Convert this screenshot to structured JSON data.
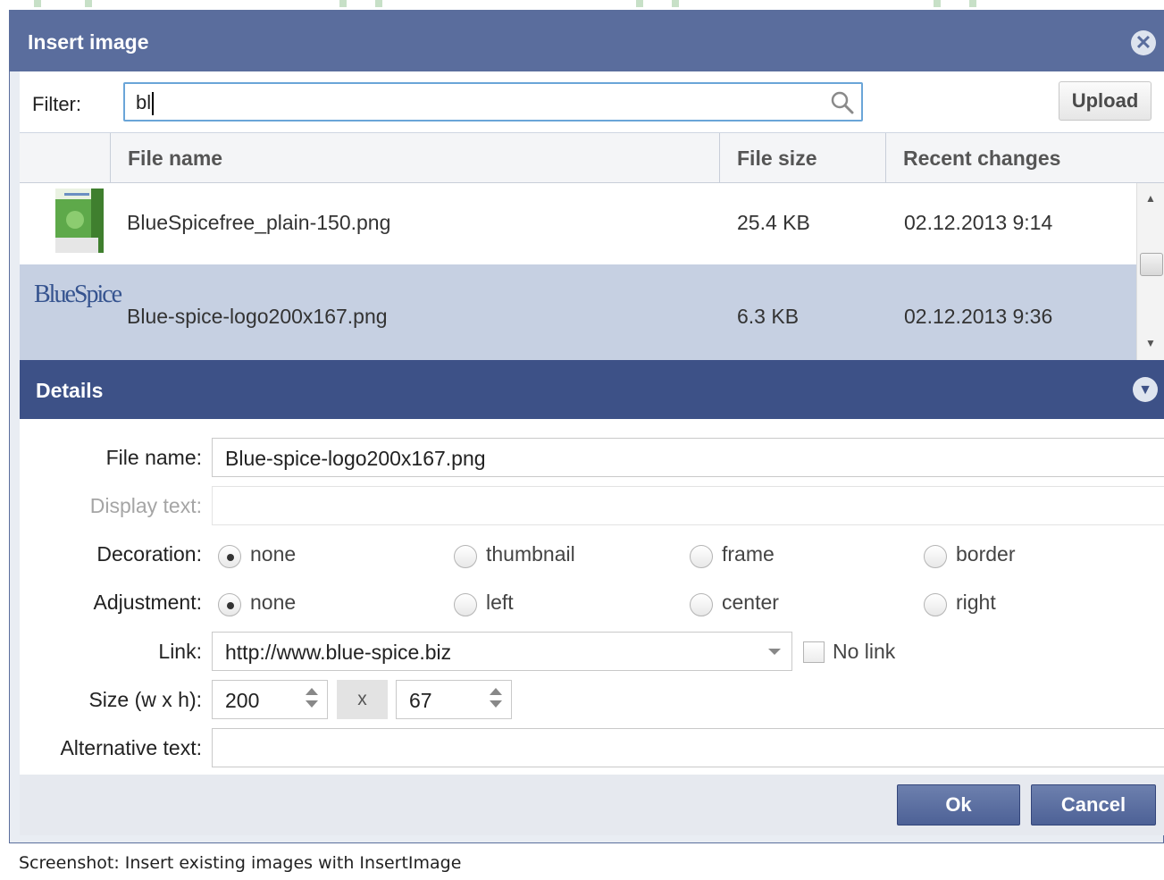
{
  "dialog": {
    "title": "Insert image",
    "close_icon": "close-circle-icon"
  },
  "filter": {
    "label": "Filter:",
    "value": "bl",
    "search_icon": "search-icon",
    "upload_label": "Upload"
  },
  "grid": {
    "columns": [
      "File name",
      "File size",
      "Recent changes"
    ],
    "rows": [
      {
        "file_name": "BlueSpicefree_plain-150.png",
        "file_size": "25.4 KB",
        "recent_changes": "02.12.2013 9:14",
        "selected": false
      },
      {
        "file_name": "Blue-spice-logo200x167.png",
        "file_size": "6.3 KB",
        "recent_changes": "02.12.2013 9:36",
        "selected": true
      }
    ],
    "logo_text": "BlueSpice"
  },
  "details": {
    "title": "Details",
    "expand_icon": "chevron-down-circle-icon",
    "file_name_label": "File name:",
    "file_name_value": "Blue-spice-logo200x167.png",
    "display_text_label": "Display text:",
    "display_text_value": "",
    "decoration": {
      "label": "Decoration:",
      "options": [
        "none",
        "thumbnail",
        "frame",
        "border"
      ],
      "selected": "none"
    },
    "adjustment": {
      "label": "Adjustment:",
      "options": [
        "none",
        "left",
        "center",
        "right"
      ],
      "selected": "none"
    },
    "link_label": "Link:",
    "link_value": "http://www.blue-spice.biz",
    "no_link_label": "No link",
    "size_label": "Size (w x h):",
    "width": "200",
    "size_separator": "x",
    "height": "67",
    "alt_text_label": "Alternative text:",
    "alt_text_value": ""
  },
  "footer": {
    "ok_label": "Ok",
    "cancel_label": "Cancel"
  },
  "caption": "Screenshot: Insert existing images with InsertImage",
  "colors": {
    "title_bar": "#5a6d9d",
    "details_bar": "#3d5187",
    "selected_row": "#c6d0e2",
    "button": "#4d6196"
  }
}
